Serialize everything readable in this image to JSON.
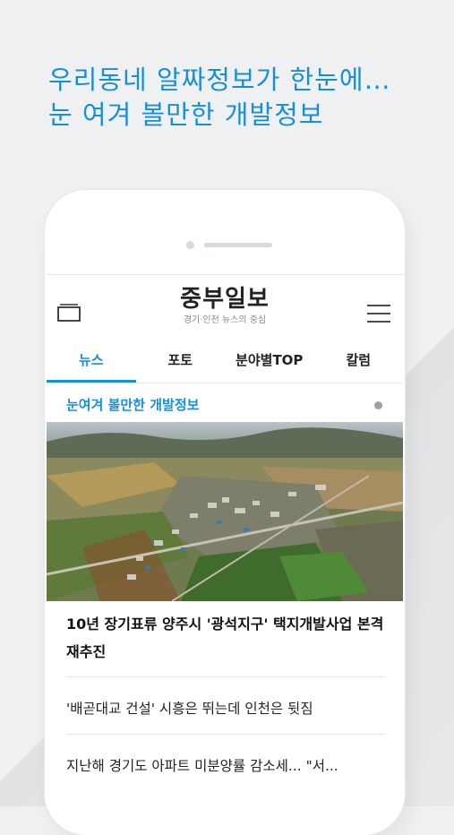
{
  "promo": {
    "line1": "우리동네 알짜정보가 한눈에…",
    "line2": "눈 여겨 볼만한 개발정보",
    "accent": "#1a8fd0"
  },
  "app": {
    "logo": "중부일보",
    "subtitle": "경기·인천 뉴스의 중심",
    "tabs_icon": "tabs-icon",
    "menu_icon": "hamburger-menu-icon"
  },
  "nav": {
    "tabs": [
      {
        "label": "뉴스",
        "active": true
      },
      {
        "label": "포토",
        "active": false
      },
      {
        "label": "분야별TOP",
        "active": false
      },
      {
        "label": "칼럼",
        "active": false
      }
    ]
  },
  "section": {
    "title": "눈여겨 볼만한 개발정보"
  },
  "articles": {
    "lead": "10년 장기표류 양주시 '광석지구' 택지개발사업 본격 재추진",
    "items": [
      "'배곧대교 건설' 시흥은 뛰는데 인천은 뒷짐",
      "지난해 경기도 아파트 미분양률 감소세... \"서..."
    ]
  }
}
